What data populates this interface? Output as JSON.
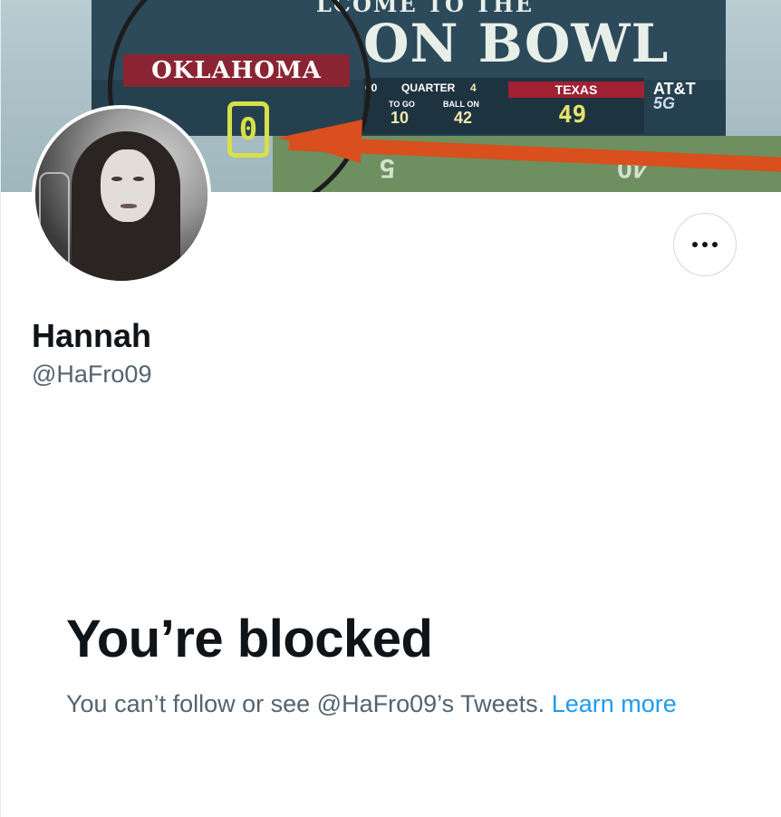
{
  "banner": {
    "welcome_text": "LCOME TO THE",
    "bowl_text": "ON BOWL",
    "home_team": "OKLAHOMA",
    "home_score": "0",
    "quarter_label": "QUARTER",
    "quarter_value": "4",
    "left_digits": "00",
    "to_go_label": "TO GO",
    "to_go_value": "10",
    "ball_on_label": "BALL ON",
    "ball_on_value": "42",
    "away_team": "TEXAS",
    "away_score": "49",
    "sponsor": "AT&T",
    "sponsor_sub": "5G",
    "yard_marker_1": "5",
    "yard_marker_2": "40",
    "arrow_color": "#d94f1e"
  },
  "profile": {
    "name": "Hannah",
    "handle": "@HaFro09",
    "more_icon": "more-horizontal-icon"
  },
  "blocked": {
    "title": "You’re blocked",
    "message": "You can’t follow or see @HaFro09’s Tweets.",
    "link_text": "Learn more",
    "link_color": "#1d9bf0"
  }
}
